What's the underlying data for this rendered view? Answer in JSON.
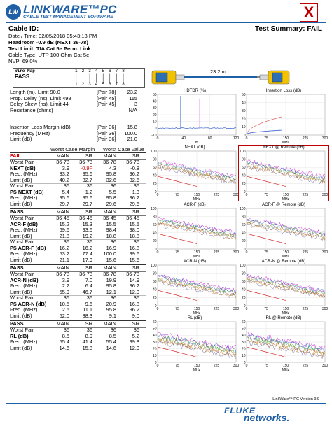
{
  "header": {
    "logo_badge": "LW",
    "app_title": "LINKWARE™PC",
    "app_subtitle": "CABLE TEST MANAGEMENT SOFTWARE",
    "close_glyph": "X"
  },
  "info": {
    "cable_id_label": "Cable ID:",
    "test_summary": "Test Summary: FAIL",
    "date_time": "Date / Time: 02/05/2018  05:43:13 PM",
    "headroom": "Headroom -0.9 dB (NEXT 36-78)",
    "test_limit": "Test Limit: TIA Cat 5e Perm. Link",
    "cable_type": "Cable Type: UTP 100 Ohm Cat 5e",
    "nvp": "NVP: 69.0%"
  },
  "wiremap": {
    "title": "Wire Map",
    "result": "PASS",
    "top_row": "1 2 3 4 5 6 7 8",
    "bars_row": "| | | | | | | |",
    "bottom_row": "1 2 3 4 5 6 7 8"
  },
  "device": {
    "length_label": "23.2 m"
  },
  "summary_table": {
    "rows": [
      {
        "label": "Length (m), Limit 90.0",
        "pair": "[Pair 78]",
        "value": "23.2"
      },
      {
        "label": "Prop. Delay (ns), Limit 498",
        "pair": "[Pair 45]",
        "value": "115"
      },
      {
        "label": "Delay Skew (ns), Limit 44",
        "pair": "[Pair 45]",
        "value": "3"
      },
      {
        "label": "Resistance (ohms)",
        "pair": "",
        "value": "N/A"
      }
    ],
    "rows2": [
      {
        "label": "Insertion Loss Margin (dB)",
        "pair": "[Pair 36]",
        "value": "15.8"
      },
      {
        "label": "Frequency (MHz)",
        "pair": "[Pair 36]",
        "value": "100.0"
      },
      {
        "label": "Limit (dB)",
        "pair": "[Pair 36]",
        "value": "21.0"
      }
    ]
  },
  "margin_headers": {
    "worst_case_margin": "Worst Case Margin",
    "worst_case_value": "Worst Case Value"
  },
  "sections": [
    {
      "status": "FAIL",
      "status_fail": true,
      "cols": [
        "MAIN",
        "SR",
        "MAIN",
        "SR"
      ],
      "rows": [
        {
          "label": "Worst Pair",
          "bold": false,
          "vals": [
            "36-78",
            "36-78",
            "36-78",
            "36-78"
          ]
        },
        {
          "label": "NEXT (dB)",
          "bold": true,
          "vals": [
            "3.9",
            "-0.9F",
            "4.3",
            "-0.8"
          ]
        },
        {
          "label": "Freq. (MHz)",
          "bold": false,
          "vals": [
            "33.2",
            "95.6",
            "95.8",
            "96.2"
          ]
        },
        {
          "label": "Limit (dB)",
          "bold": false,
          "vals": [
            "40.2",
            "32.7",
            "32.6",
            "32.6"
          ]
        },
        {
          "label": "Worst Pair",
          "bold": false,
          "vals": [
            "36",
            "36",
            "36",
            "36"
          ]
        },
        {
          "label": "PS NEXT (dB)",
          "bold": true,
          "vals": [
            "5.4",
            "1.2",
            "5.5",
            "1.3"
          ]
        },
        {
          "label": "Freq. (MHz)",
          "bold": false,
          "vals": [
            "95.6",
            "95.6",
            "95.8",
            "96.2"
          ]
        },
        {
          "label": "Limit (dB)",
          "bold": false,
          "vals": [
            "29.7",
            "29.7",
            "29.6",
            "29.6"
          ]
        }
      ]
    },
    {
      "status": "PASS",
      "status_fail": false,
      "cols": [
        "MAIN",
        "SR",
        "MAIN",
        "SR"
      ],
      "rows": [
        {
          "label": "Worst Pair",
          "bold": false,
          "vals": [
            "36-45",
            "36-45",
            "36-45",
            "36-45"
          ]
        },
        {
          "label": "ACR-F (dB)",
          "bold": true,
          "vals": [
            "15.2",
            "15.3",
            "15.5",
            "15.5"
          ]
        },
        {
          "label": "Freq. (MHz)",
          "bold": false,
          "vals": [
            "69.6",
            "93.6",
            "98.4",
            "98.0"
          ]
        },
        {
          "label": "Limit (dB)",
          "bold": false,
          "vals": [
            "21.8",
            "19.2",
            "18.8",
            "18.8"
          ]
        },
        {
          "label": "Worst Pair",
          "bold": false,
          "vals": [
            "36",
            "36",
            "36",
            "36"
          ]
        },
        {
          "label": "PS ACR-F (dB)",
          "bold": true,
          "vals": [
            "16.2",
            "16.2",
            "16.9",
            "16.8"
          ]
        },
        {
          "label": "Freq. (MHz)",
          "bold": false,
          "vals": [
            "53.2",
            "77.4",
            "100.0",
            "99.6"
          ]
        },
        {
          "label": "Limit (dB)",
          "bold": false,
          "vals": [
            "21.1",
            "17.9",
            "15.6",
            "15.6"
          ]
        }
      ]
    },
    {
      "status": "PASS",
      "status_fail": false,
      "cols": [
        "MAIN",
        "SR",
        "MAIN",
        "SR"
      ],
      "rows": [
        {
          "label": "Worst Pair",
          "bold": false,
          "vals": [
            "36-78",
            "36-78",
            "36-78",
            "36-78"
          ]
        },
        {
          "label": "ACR-N (dB)",
          "bold": true,
          "vals": [
            "3.9",
            "7.0",
            "19.9",
            "14.9"
          ]
        },
        {
          "label": "Freq. (MHz)",
          "bold": false,
          "vals": [
            "2.2",
            "6.4",
            "95.8",
            "96.2"
          ]
        },
        {
          "label": "Limit (dB)",
          "bold": false,
          "vals": [
            "55.9",
            "46.7",
            "12.1",
            "12.0"
          ]
        },
        {
          "label": "Worst Pair",
          "bold": false,
          "vals": [
            "36",
            "36",
            "36",
            "36"
          ]
        },
        {
          "label": "PS ACR-N (dB)",
          "bold": true,
          "vals": [
            "10.5",
            "9.6",
            "20.9",
            "16.8"
          ]
        },
        {
          "label": "Freq. (MHz)",
          "bold": false,
          "vals": [
            "2.5",
            "11.1",
            "95.8",
            "96.2"
          ]
        },
        {
          "label": "Limit (dB)",
          "bold": false,
          "vals": [
            "52.0",
            "38.3",
            "9.1",
            "9.0"
          ]
        }
      ]
    },
    {
      "status": "PASS",
      "status_fail": false,
      "cols": [
        "MAIN",
        "SR",
        "MAIN",
        "SR"
      ],
      "rows": [
        {
          "label": "Worst Pair",
          "bold": false,
          "vals": [
            "36",
            "36",
            "36",
            "36"
          ]
        },
        {
          "label": "RL (dB)",
          "bold": true,
          "vals": [
            "8.5",
            "8.9",
            "8.5",
            "5.2"
          ]
        },
        {
          "label": "Freq. (MHz)",
          "bold": false,
          "vals": [
            "55.4",
            "41.4",
            "55.4",
            "99.8"
          ]
        },
        {
          "label": "Limit (dB)",
          "bold": false,
          "vals": [
            "14.6",
            "15.8",
            "14.6",
            "12.0"
          ]
        }
      ]
    }
  ],
  "charts": [
    {
      "title": "HDTDR (%)",
      "yticks": [
        "50",
        "40",
        "30",
        "20",
        "10",
        "0",
        "-10"
      ],
      "xticks": [
        "0",
        "40",
        "80",
        "120"
      ],
      "xunit": "m",
      "kind": "tdr"
    },
    {
      "title": "Insertion Loss (dB)",
      "yticks": [
        "50",
        "40",
        "30",
        "20",
        "10",
        "0"
      ],
      "xticks": [
        "0",
        "75",
        "150",
        "225",
        "300"
      ],
      "xunit": "MHz",
      "kind": "il"
    },
    {
      "title": "NEXT (dB)",
      "yticks": [
        "100",
        "80",
        "60",
        "40",
        "20",
        "0"
      ],
      "xticks": [
        "0",
        "75",
        "150",
        "225",
        "300"
      ],
      "xunit": "MHz",
      "kind": "next"
    },
    {
      "title": "NEXT @ Remote (dB)",
      "yticks": [
        "100",
        "80",
        "60",
        "40",
        "20",
        "0"
      ],
      "xticks": [
        "0",
        "75",
        "150",
        "225",
        "300"
      ],
      "xunit": "MHz",
      "kind": "next",
      "highlight": true
    },
    {
      "title": "ACR-F (dB)",
      "yticks": [
        "100",
        "80",
        "60",
        "40",
        "20",
        "0"
      ],
      "xticks": [
        "0",
        "75",
        "150",
        "225",
        "300"
      ],
      "xunit": "MHz",
      "kind": "acrf"
    },
    {
      "title": "ACR-F @ Remote (dB)",
      "yticks": [
        "100",
        "80",
        "60",
        "40",
        "20",
        "0"
      ],
      "xticks": [
        "0",
        "75",
        "150",
        "225",
        "300"
      ],
      "xunit": "MHz",
      "kind": "acrf"
    },
    {
      "title": "ACR-N (dB)",
      "yticks": [
        "100",
        "80",
        "60",
        "40",
        "20",
        "0"
      ],
      "xticks": [
        "0",
        "75",
        "150",
        "225",
        "300"
      ],
      "xunit": "MHz",
      "kind": "acrn"
    },
    {
      "title": "ACR-N @ Remote (dB)",
      "yticks": [
        "100",
        "80",
        "60",
        "40",
        "20",
        "0"
      ],
      "xticks": [
        "0",
        "75",
        "150",
        "225",
        "300"
      ],
      "xunit": "MHz",
      "kind": "acrn"
    },
    {
      "title": "RL (dB)",
      "yticks": [
        "60",
        "50",
        "40",
        "30",
        "20",
        "10",
        "0"
      ],
      "xticks": [
        "0",
        "75",
        "150",
        "225",
        "300"
      ],
      "xunit": "MHz",
      "kind": "rl"
    },
    {
      "title": "RL @ Remote (dB)",
      "yticks": [
        "60",
        "50",
        "40",
        "30",
        "20",
        "10",
        "0"
      ],
      "xticks": [
        "0",
        "75",
        "150",
        "225",
        "300"
      ],
      "xunit": "MHz",
      "kind": "rl"
    }
  ],
  "footer": {
    "version": "LinkWare™ PC Version 9.9",
    "brand_top": "FLUKE",
    "brand_bottom": "networks."
  },
  "colors": {
    "brand_blue": "#1f5fa6",
    "fail_red": "#d40000",
    "highlight_border": "#c00000"
  }
}
